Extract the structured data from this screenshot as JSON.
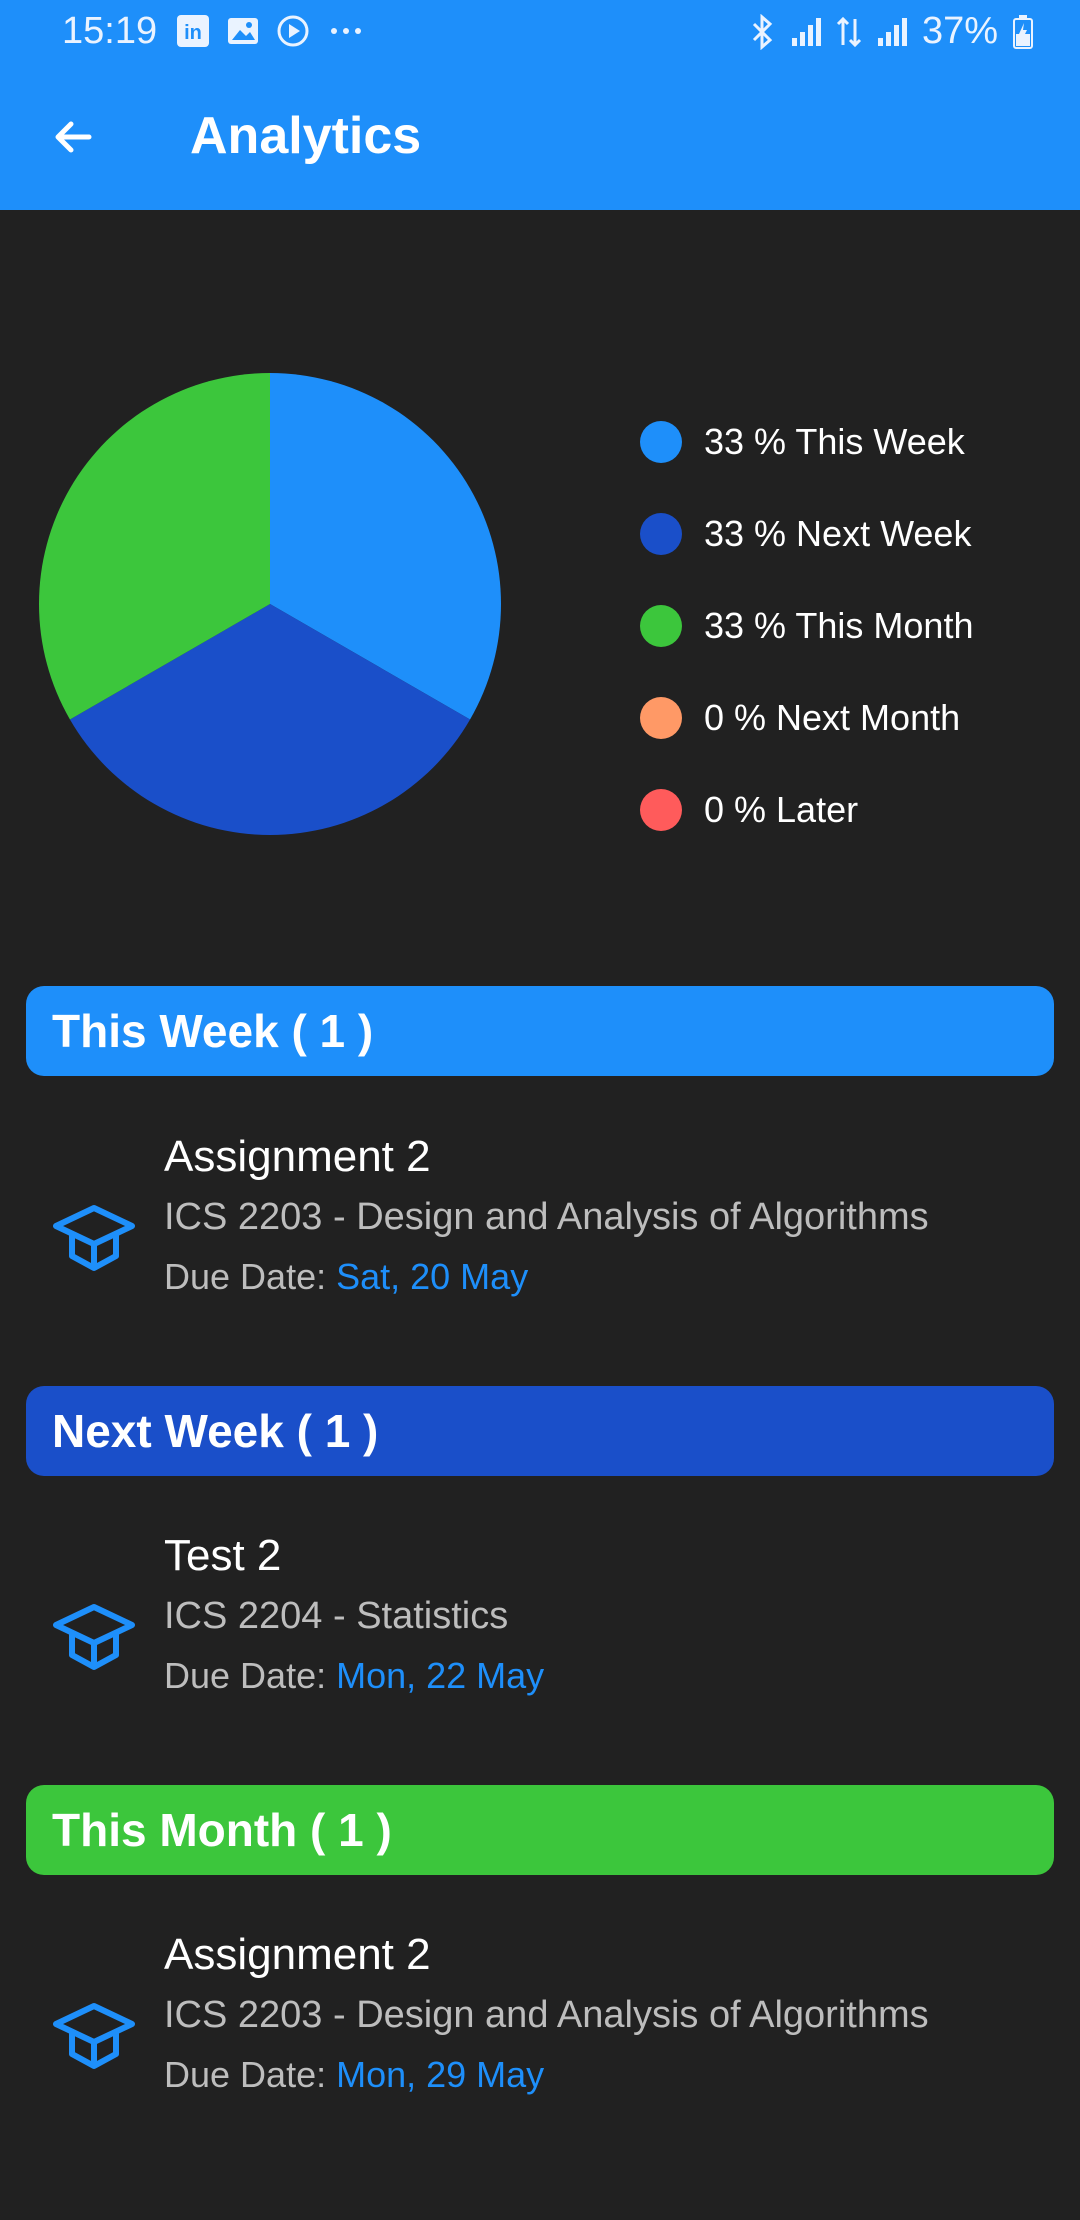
{
  "status_bar": {
    "time": "15:19",
    "battery": "37%",
    "icons_left": [
      "linkedin-icon",
      "image-icon",
      "play-icon",
      "more-icon"
    ],
    "icons_right": [
      "bluetooth-icon",
      "signal-icon",
      "data-icon",
      "signal-icon",
      "battery-icon"
    ]
  },
  "app_bar": {
    "title": "Analytics"
  },
  "chart_data": {
    "type": "pie",
    "slices": [
      {
        "label": "This Week",
        "value": 33,
        "color": "#1e8ffa"
      },
      {
        "label": "Next Week",
        "value": 33,
        "color": "#1a4fc9"
      },
      {
        "label": "This Month",
        "value": 33,
        "color": "#3cc63c"
      },
      {
        "label": "Next Month",
        "value": 0,
        "color": "#ff9966"
      },
      {
        "label": "Later",
        "value": 0,
        "color": "#ff5b5b"
      }
    ],
    "legend_placement": "right"
  },
  "legend": [
    {
      "text": "33 % This Week",
      "color": "#1e8ffa"
    },
    {
      "text": "33 % Next Week",
      "color": "#1a4fc9"
    },
    {
      "text": "33 % This Month",
      "color": "#3cc63c"
    },
    {
      "text": "0 % Next Month",
      "color": "#ff9966"
    },
    {
      "text": "0 % Later",
      "color": "#ff5b5b"
    }
  ],
  "sections": [
    {
      "header": "This Week ( 1 )",
      "color": "#1e8ffa",
      "task": {
        "title": "Assignment 2",
        "course": "ICS 2203 - Design and Analysis of Algorithms",
        "due_label": "Due Date: ",
        "due_date": "Sat, 20 May"
      }
    },
    {
      "header": "Next Week ( 1 )",
      "color": "#1a4fc9",
      "task": {
        "title": "Test 2",
        "course": "ICS 2204 - Statistics",
        "due_label": "Due Date: ",
        "due_date": "Mon, 22 May"
      }
    },
    {
      "header": "This Month ( 1 )",
      "color": "#3cc63c",
      "task": {
        "title": "Assignment 2",
        "course": "ICS 2203 - Design and Analysis of Algorithms",
        "due_label": "Due Date: ",
        "due_date": "Mon, 29 May"
      }
    }
  ],
  "colors": {
    "accent": "#1e8ffa",
    "background": "#212121",
    "secondary_text": "#bdbdbd"
  }
}
